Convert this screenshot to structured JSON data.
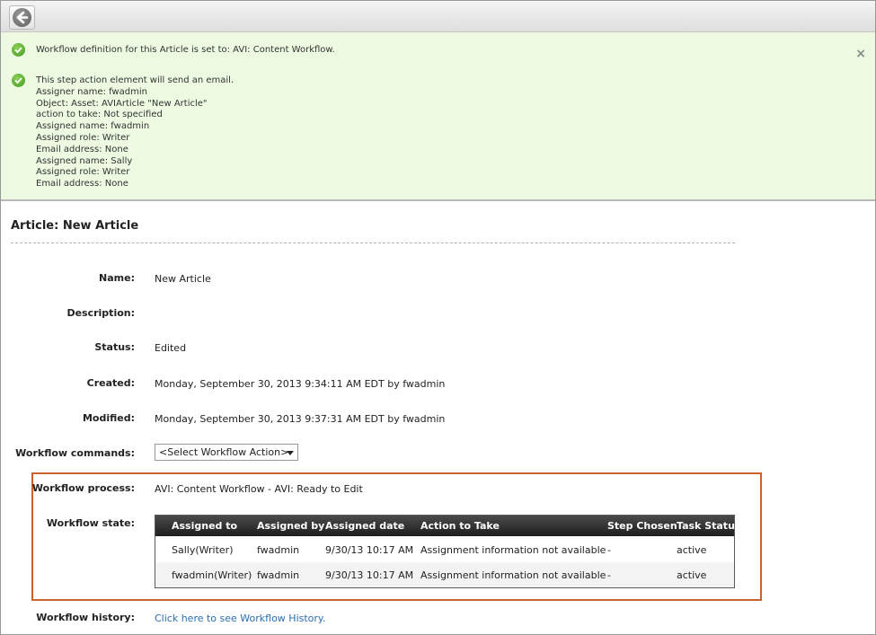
{
  "messages": {
    "definition": "Workflow definition for this Article is set to: AVI: Content Workflow.",
    "details": [
      "This step action element will send an email.",
      "Assigner name: fwadmin",
      "Object: Asset: AVIArticle \"New Article\"",
      "action to take: Not specified",
      "Assigned name: fwadmin",
      "Assigned role: Writer",
      "Email address: None",
      "Assigned name: Sally",
      "Assigned role: Writer",
      "Email address: None"
    ],
    "close_glyph": "×"
  },
  "article": {
    "title": "Article: New Article",
    "fields": {
      "name_label": "Name:",
      "name_value": "New Article",
      "description_label": "Description:",
      "description_value": "",
      "status_label": "Status:",
      "status_value": "Edited",
      "created_label": "Created:",
      "created_value": "Monday, September 30, 2013 9:34:11 AM EDT by fwadmin",
      "modified_label": "Modified:",
      "modified_value": "Monday, September 30, 2013 9:37:31 AM EDT by fwadmin",
      "commands_label": "Workflow commands:",
      "commands_selected": "<Select Workflow Action>",
      "process_label": "Workflow process:",
      "process_value": "AVI: Content Workflow - AVI: Ready to Edit",
      "state_label": "Workflow state:",
      "history_label": "Workflow history:",
      "history_link": "Click here to see Workflow History."
    }
  },
  "workflow_table": {
    "headers": [
      "Assigned to",
      "Assigned by",
      "Assigned date",
      "Action to Take",
      "Step Chosen",
      "Task Status"
    ],
    "rows": [
      [
        "Sally(Writer)",
        "fwadmin",
        "9/30/13 10:17 AM",
        "Assignment information not available",
        "-",
        "active"
      ],
      [
        "fwadmin(Writer)",
        "fwadmin",
        "9/30/13 10:17 AM",
        "Assignment information not available",
        "-",
        "active"
      ]
    ]
  },
  "icons": {
    "back": "back-arrow-icon",
    "check": "check-icon",
    "close": "close-icon"
  },
  "colors": {
    "message_bg": "#eef9e2",
    "highlight_border": "#c8642a",
    "link": "#2a6fb3",
    "table_header": "#2a2a2a"
  }
}
